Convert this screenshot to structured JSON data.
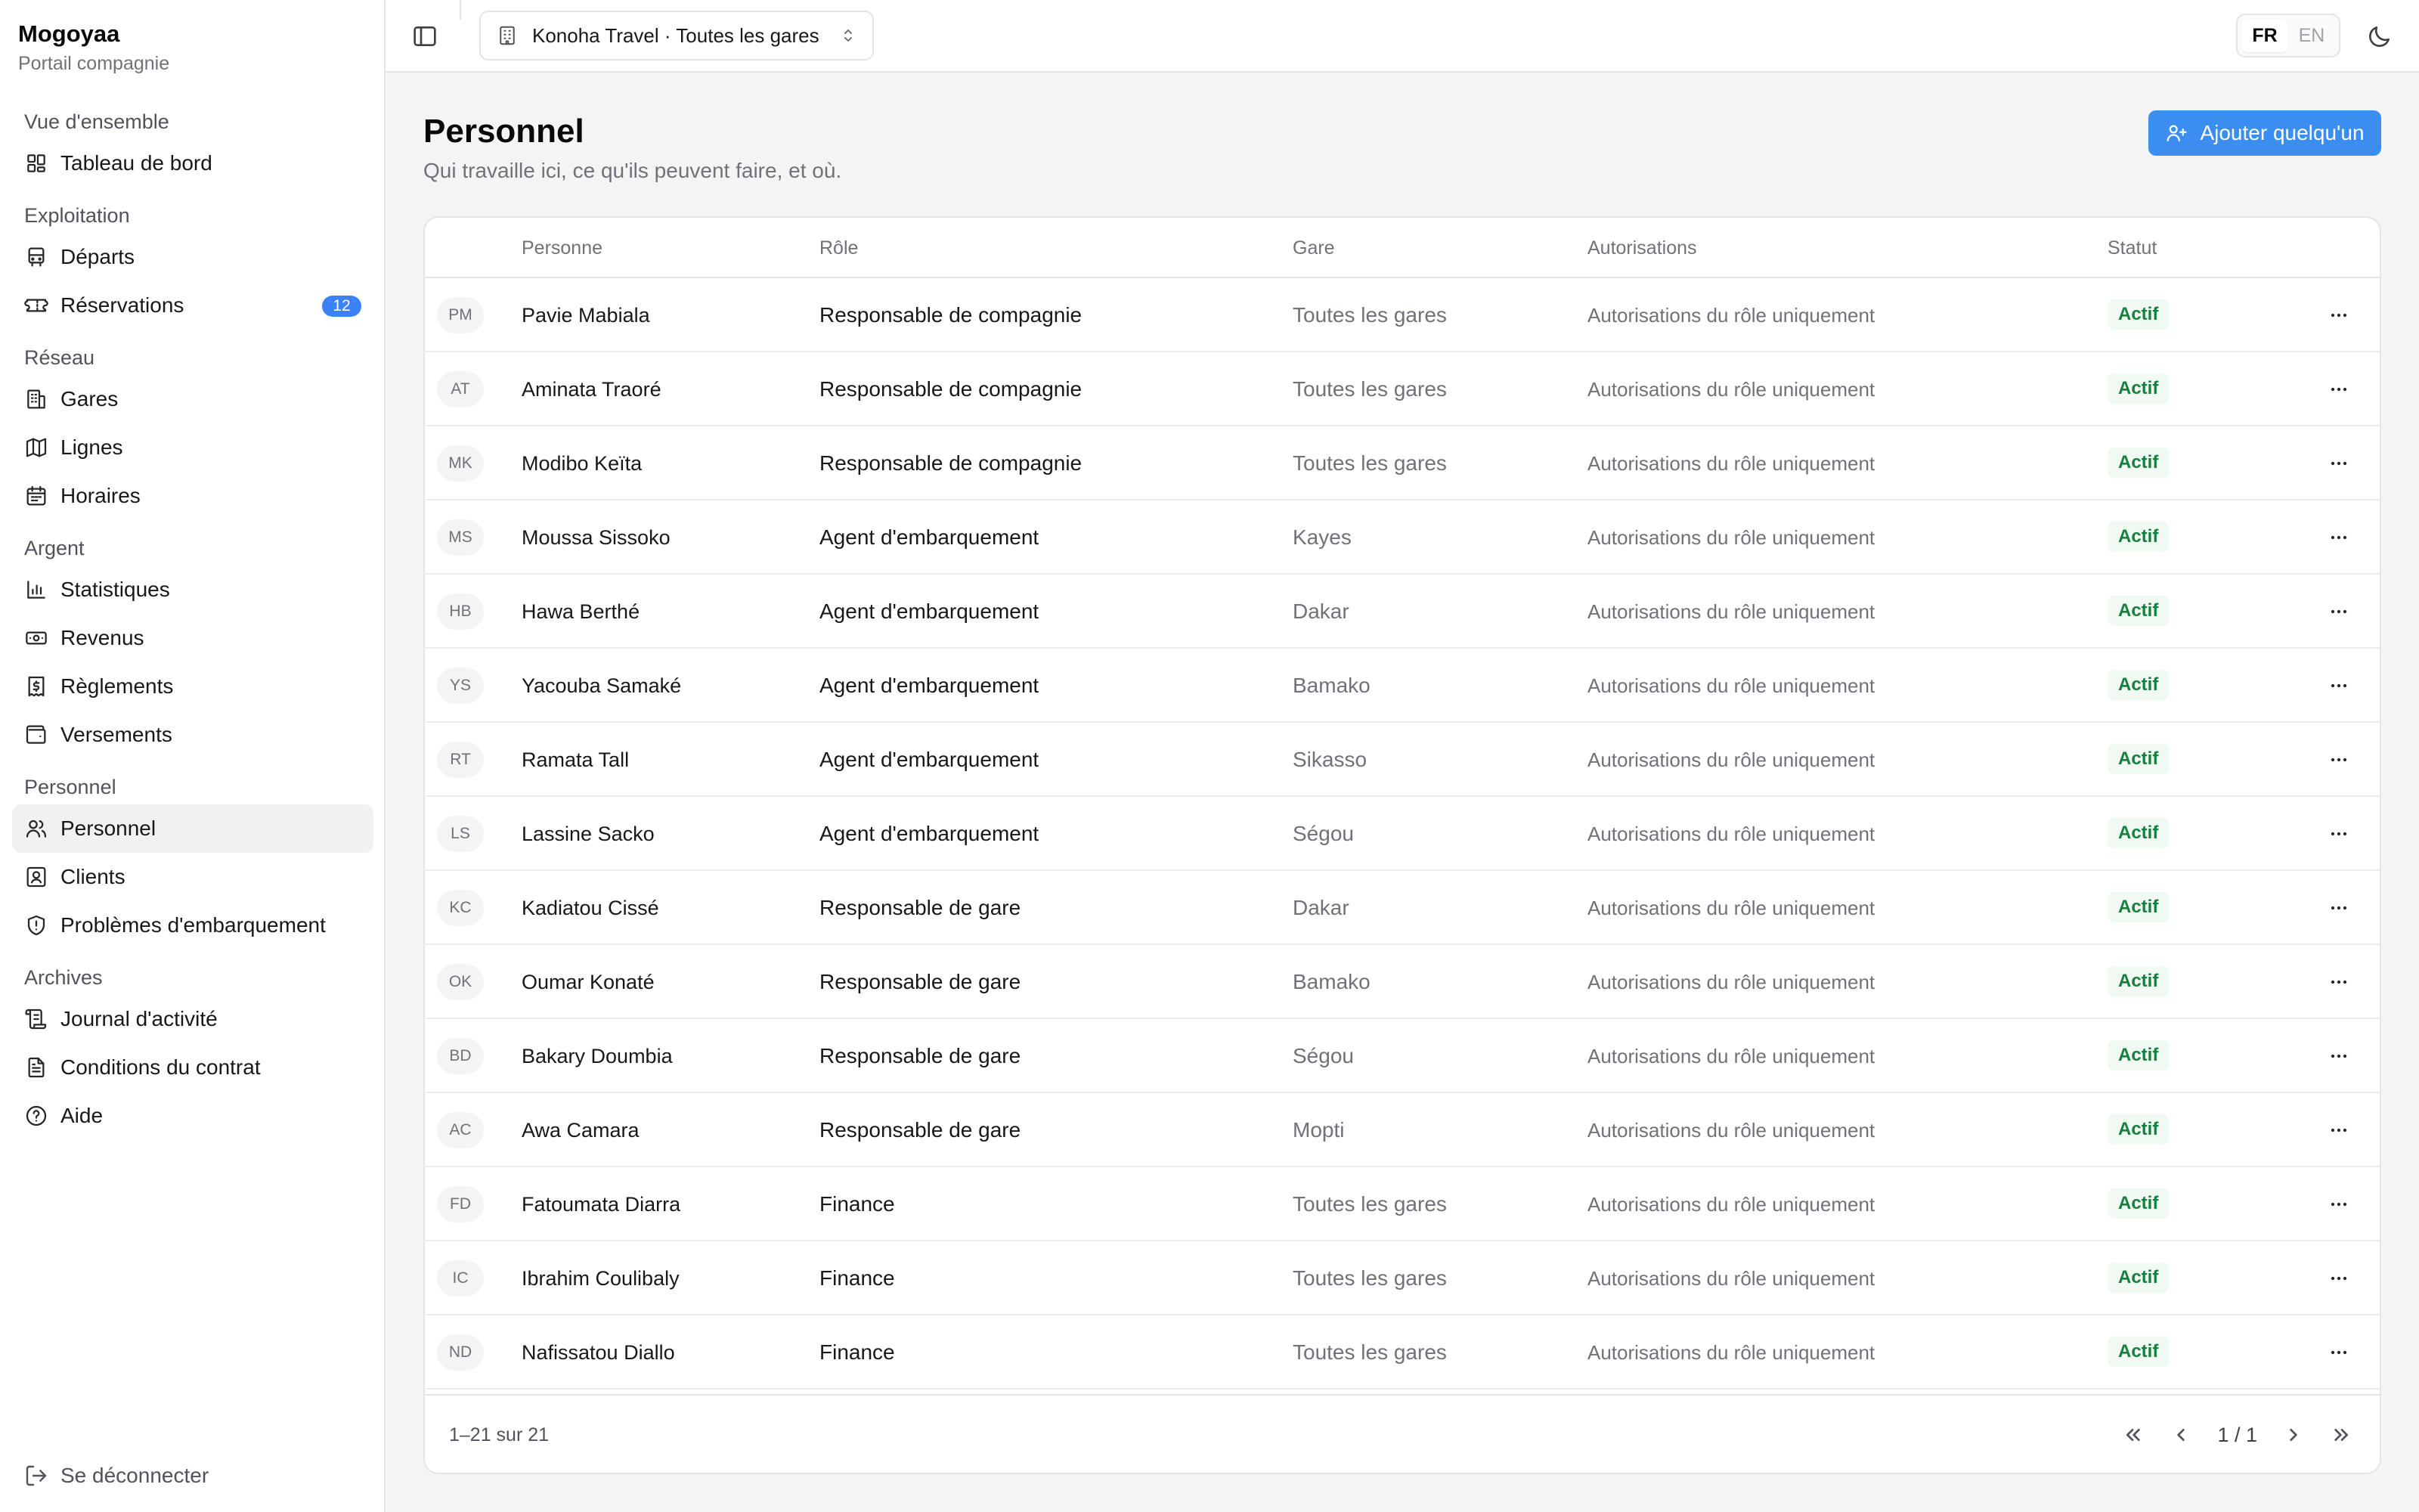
{
  "brand": {
    "name": "Mogoyaa",
    "subtitle": "Portail compagnie"
  },
  "sidebar": {
    "groups": [
      {
        "label": "Vue d'ensemble",
        "items": [
          {
            "label": "Tableau de bord",
            "icon": "dashboard-icon"
          }
        ]
      },
      {
        "label": "Exploitation",
        "items": [
          {
            "label": "Départs",
            "icon": "bus-icon"
          },
          {
            "label": "Réservations",
            "icon": "ticket-icon",
            "badge": "12"
          }
        ]
      },
      {
        "label": "Réseau",
        "items": [
          {
            "label": "Gares",
            "icon": "building-icon"
          },
          {
            "label": "Lignes",
            "icon": "map-icon"
          },
          {
            "label": "Horaires",
            "icon": "calendar-icon"
          }
        ]
      },
      {
        "label": "Argent",
        "items": [
          {
            "label": "Statistiques",
            "icon": "bar-chart-icon"
          },
          {
            "label": "Revenus",
            "icon": "banknote-icon"
          },
          {
            "label": "Règlements",
            "icon": "receipt-icon"
          },
          {
            "label": "Versements",
            "icon": "wallet-icon"
          }
        ]
      },
      {
        "label": "Personnel",
        "items": [
          {
            "label": "Personnel",
            "icon": "users-icon",
            "active": true
          },
          {
            "label": "Clients",
            "icon": "contact-icon"
          },
          {
            "label": "Problèmes d'embarquement",
            "icon": "shield-alert-icon"
          }
        ]
      },
      {
        "label": "Archives",
        "items": [
          {
            "label": "Journal d'activité",
            "icon": "scroll-icon"
          },
          {
            "label": "Conditions du contrat",
            "icon": "file-text-icon"
          },
          {
            "label": "Aide",
            "icon": "help-circle-icon"
          }
        ]
      }
    ],
    "logout_label": "Se déconnecter"
  },
  "topbar": {
    "org_selector": "Konoha Travel · Toutes les gares",
    "languages": [
      "FR",
      "EN"
    ],
    "active_language": "FR"
  },
  "page": {
    "title": "Personnel",
    "subtitle": "Qui travaille ici, ce qu'ils peuvent faire, et où.",
    "add_button": "Ajouter quelqu'un"
  },
  "table": {
    "columns": [
      "Personne",
      "Rôle",
      "Gare",
      "Autorisations",
      "Statut"
    ],
    "rows": [
      {
        "initials": "PM",
        "name": "Pavie Mabiala",
        "role": "Responsable de compagnie",
        "station": "Toutes les gares",
        "permissions": "Autorisations du rôle uniquement",
        "status": "Actif"
      },
      {
        "initials": "AT",
        "name": "Aminata Traoré",
        "role": "Responsable de compagnie",
        "station": "Toutes les gares",
        "permissions": "Autorisations du rôle uniquement",
        "status": "Actif"
      },
      {
        "initials": "MK",
        "name": "Modibo Keïta",
        "role": "Responsable de compagnie",
        "station": "Toutes les gares",
        "permissions": "Autorisations du rôle uniquement",
        "status": "Actif"
      },
      {
        "initials": "MS",
        "name": "Moussa Sissoko",
        "role": "Agent d'embarquement",
        "station": "Kayes",
        "permissions": "Autorisations du rôle uniquement",
        "status": "Actif"
      },
      {
        "initials": "HB",
        "name": "Hawa Berthé",
        "role": "Agent d'embarquement",
        "station": "Dakar",
        "permissions": "Autorisations du rôle uniquement",
        "status": "Actif"
      },
      {
        "initials": "YS",
        "name": "Yacouba Samaké",
        "role": "Agent d'embarquement",
        "station": "Bamako",
        "permissions": "Autorisations du rôle uniquement",
        "status": "Actif"
      },
      {
        "initials": "RT",
        "name": "Ramata Tall",
        "role": "Agent d'embarquement",
        "station": "Sikasso",
        "permissions": "Autorisations du rôle uniquement",
        "status": "Actif"
      },
      {
        "initials": "LS",
        "name": "Lassine Sacko",
        "role": "Agent d'embarquement",
        "station": "Ségou",
        "permissions": "Autorisations du rôle uniquement",
        "status": "Actif"
      },
      {
        "initials": "KC",
        "name": "Kadiatou Cissé",
        "role": "Responsable de gare",
        "station": "Dakar",
        "permissions": "Autorisations du rôle uniquement",
        "status": "Actif"
      },
      {
        "initials": "OK",
        "name": "Oumar Konaté",
        "role": "Responsable de gare",
        "station": "Bamako",
        "permissions": "Autorisations du rôle uniquement",
        "status": "Actif"
      },
      {
        "initials": "BD",
        "name": "Bakary Doumbia",
        "role": "Responsable de gare",
        "station": "Ségou",
        "permissions": "Autorisations du rôle uniquement",
        "status": "Actif"
      },
      {
        "initials": "AC",
        "name": "Awa Camara",
        "role": "Responsable de gare",
        "station": "Mopti",
        "permissions": "Autorisations du rôle uniquement",
        "status": "Actif"
      },
      {
        "initials": "FD",
        "name": "Fatoumata Diarra",
        "role": "Finance",
        "station": "Toutes les gares",
        "permissions": "Autorisations du rôle uniquement",
        "status": "Actif"
      },
      {
        "initials": "IC",
        "name": "Ibrahim Coulibaly",
        "role": "Finance",
        "station": "Toutes les gares",
        "permissions": "Autorisations du rôle uniquement",
        "status": "Actif"
      },
      {
        "initials": "ND",
        "name": "Nafissatou Diallo",
        "role": "Finance",
        "station": "Toutes les gares",
        "permissions": "Autorisations du rôle uniquement",
        "status": "Actif"
      }
    ]
  },
  "pagination": {
    "range_text": "1–21 sur 21",
    "page_text": "1 / 1"
  },
  "colors": {
    "accent": "#3b8ef0",
    "badge": "#3b82f6",
    "status_text": "#15803d",
    "status_bg": "#f0faf3"
  }
}
